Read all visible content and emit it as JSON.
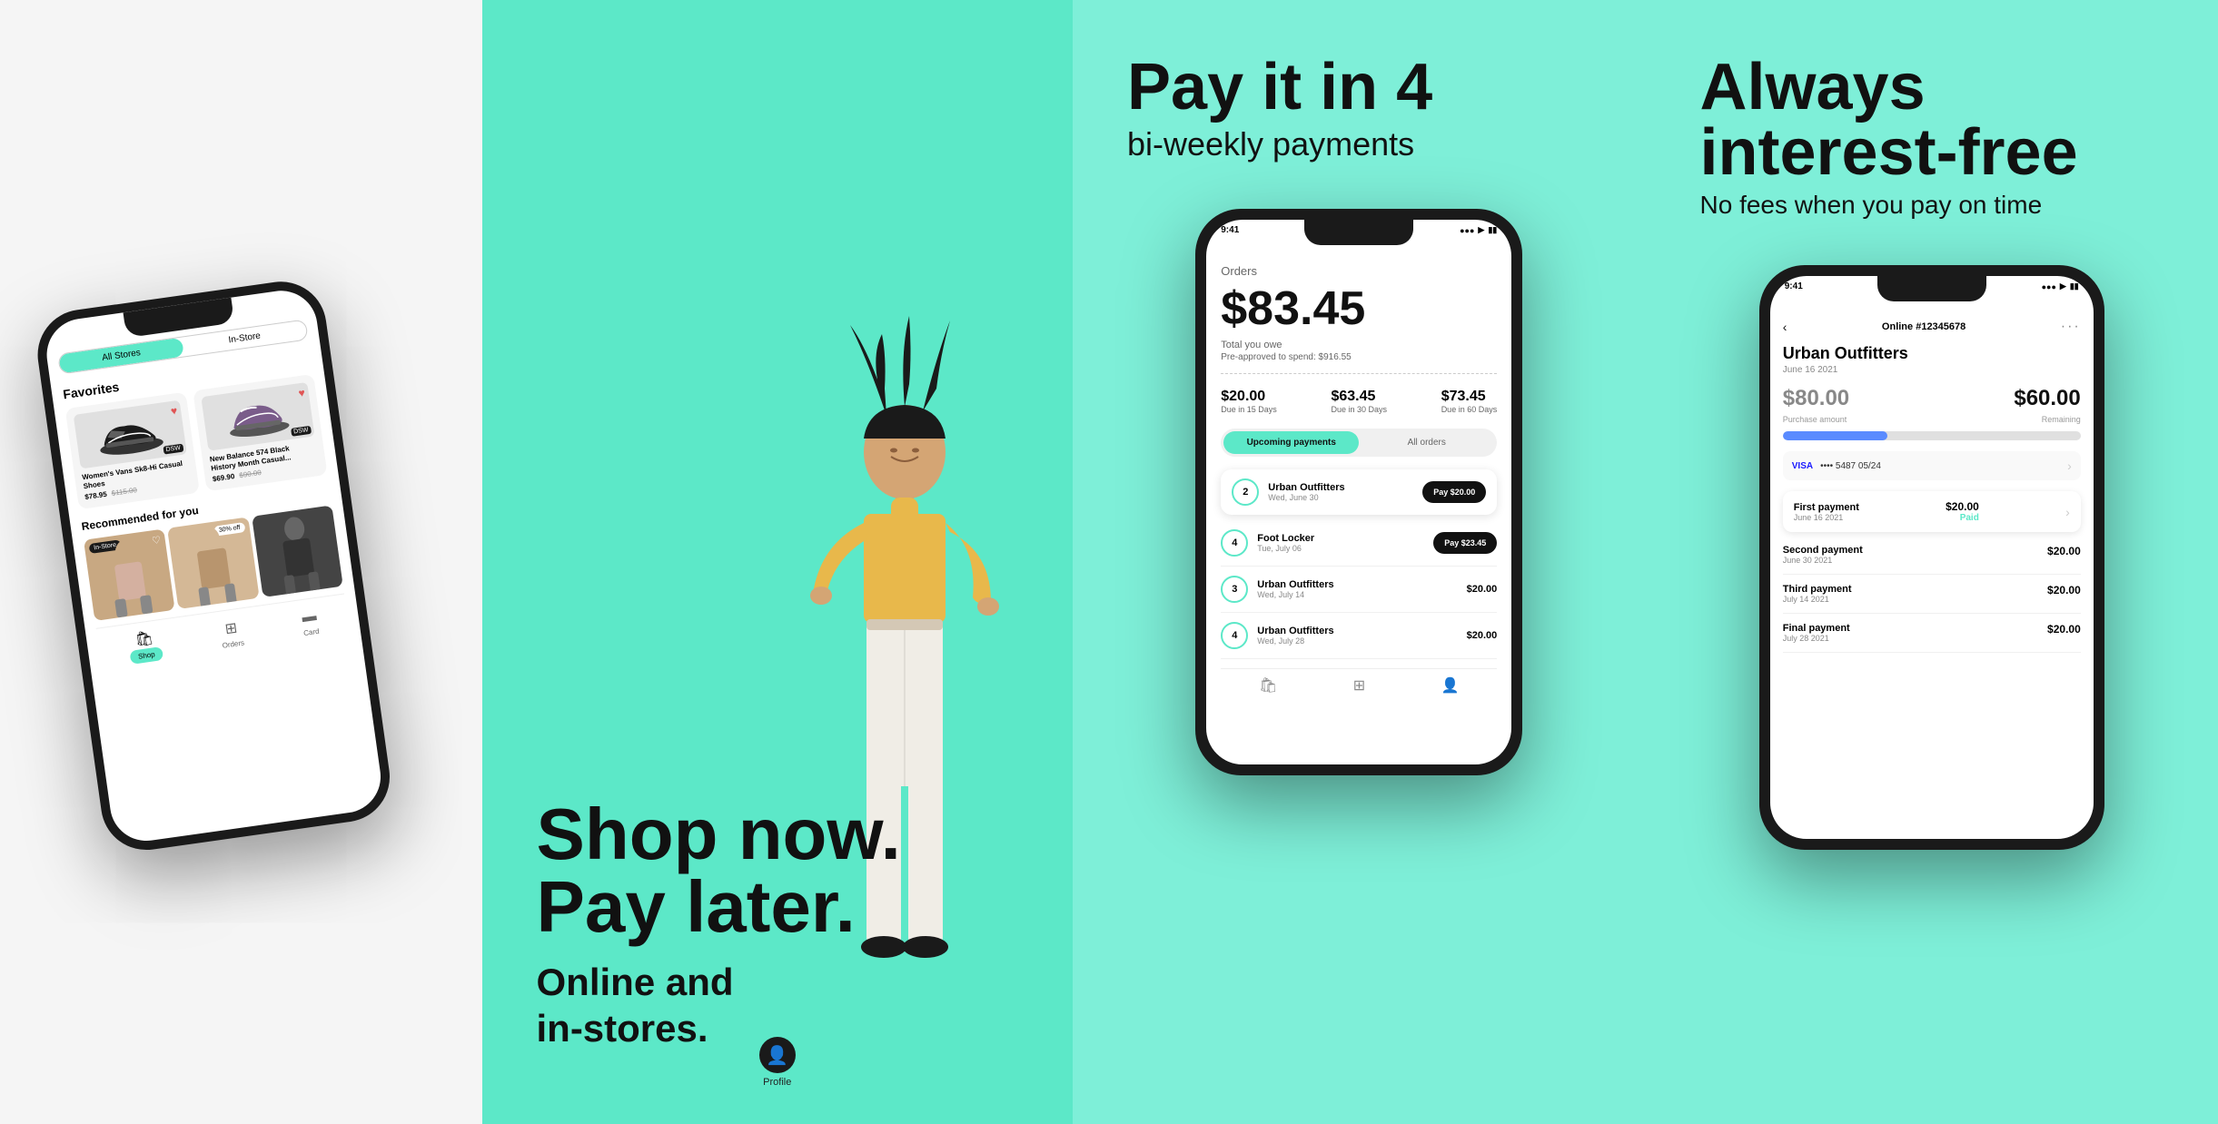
{
  "panel1": {
    "tabs": [
      "All Stores",
      "In-Store"
    ],
    "active_tab": "All Stores",
    "favorites_title": "Favorites",
    "products": [
      {
        "name": "Women's Vans Sk8-Hi Casual Shoes",
        "sale_price": "$78.95",
        "original_price": "$115.00",
        "badge": "DSW",
        "has_heart": true
      },
      {
        "name": "New Balance 574 Black History Month Casual...",
        "sale_price": "$69.90",
        "original_price": "$90.00",
        "badge": "DSW",
        "has_heart": true
      }
    ],
    "recommended_title": "Recommended for you",
    "reco_badge": "In-Store",
    "reco_sale_badge": "30% off",
    "nav_items": [
      "Shop",
      "Orders",
      "Card"
    ],
    "nav_active": "Shop"
  },
  "panel2": {
    "headline_line1": "Shop now.",
    "headline_line2": "Pay later.",
    "subtext_line1": "Online and",
    "subtext_line2": "in-stores.",
    "bottom_label": "Profile"
  },
  "panel3": {
    "headline": "Pay it in 4",
    "subtext": "bi-weekly payments",
    "screen": {
      "status_time": "9:41",
      "orders_label": "Orders",
      "total_amount": "$83.45",
      "total_owe_label": "Total you owe",
      "pre_approved": "Pre-approved to spend: $916.55",
      "payments": [
        {
          "amount": "$20.00",
          "due": "Due in 15 Days"
        },
        {
          "amount": "$63.45",
          "due": "Due in 30 Days"
        },
        {
          "amount": "$73.45",
          "due": "Due in 60 Days"
        }
      ],
      "tabs": [
        "Upcoming payments",
        "All orders"
      ],
      "active_tab": "Upcoming payments",
      "orders": [
        {
          "num": "2",
          "store": "Urban Outfitters",
          "date": "Wed, June 30",
          "action": "Pay $20.00",
          "highlighted": true
        },
        {
          "num": "4",
          "store": "Foot Locker",
          "date": "Tue, July 06",
          "action": "Pay $23.45",
          "highlighted": false
        },
        {
          "num": "3",
          "store": "Urban Outfitters",
          "date": "Wed, July 14",
          "amount": "$20.00",
          "highlighted": false
        },
        {
          "num": "4",
          "store": "Urban Outfitters",
          "date": "Wed, July 28",
          "amount": "$20.00",
          "highlighted": false
        }
      ]
    }
  },
  "panel4": {
    "headline_line1": "Always",
    "headline_line2": "interest-free",
    "subtext": "No fees when you pay on time",
    "screen": {
      "status_time": "9:41",
      "back_label": "‹",
      "order_id": "Online #12345678",
      "more_icon": "···",
      "merchant_name": "Urban Outfitters",
      "purchase_date": "June 16 2021",
      "purchase_amount": "$80.00",
      "remaining_amount": "$60.00",
      "purchase_label": "Purchase amount",
      "remaining_label": "Remaining",
      "progress_pct": 35,
      "card_visa": "VISA",
      "card_num": "•••• 5487  05/24",
      "payments": [
        {
          "name": "First payment",
          "date": "June 16 2021",
          "amount": "$20.00",
          "status": "Paid",
          "highlighted": true
        },
        {
          "name": "Second payment",
          "date": "June 30 2021",
          "amount": "$20.00",
          "status": ""
        },
        {
          "name": "Third payment",
          "date": "July 14 2021",
          "amount": "$20.00",
          "status": ""
        },
        {
          "name": "Final payment",
          "date": "July 28 2021",
          "amount": "$20.00",
          "status": ""
        }
      ]
    }
  }
}
